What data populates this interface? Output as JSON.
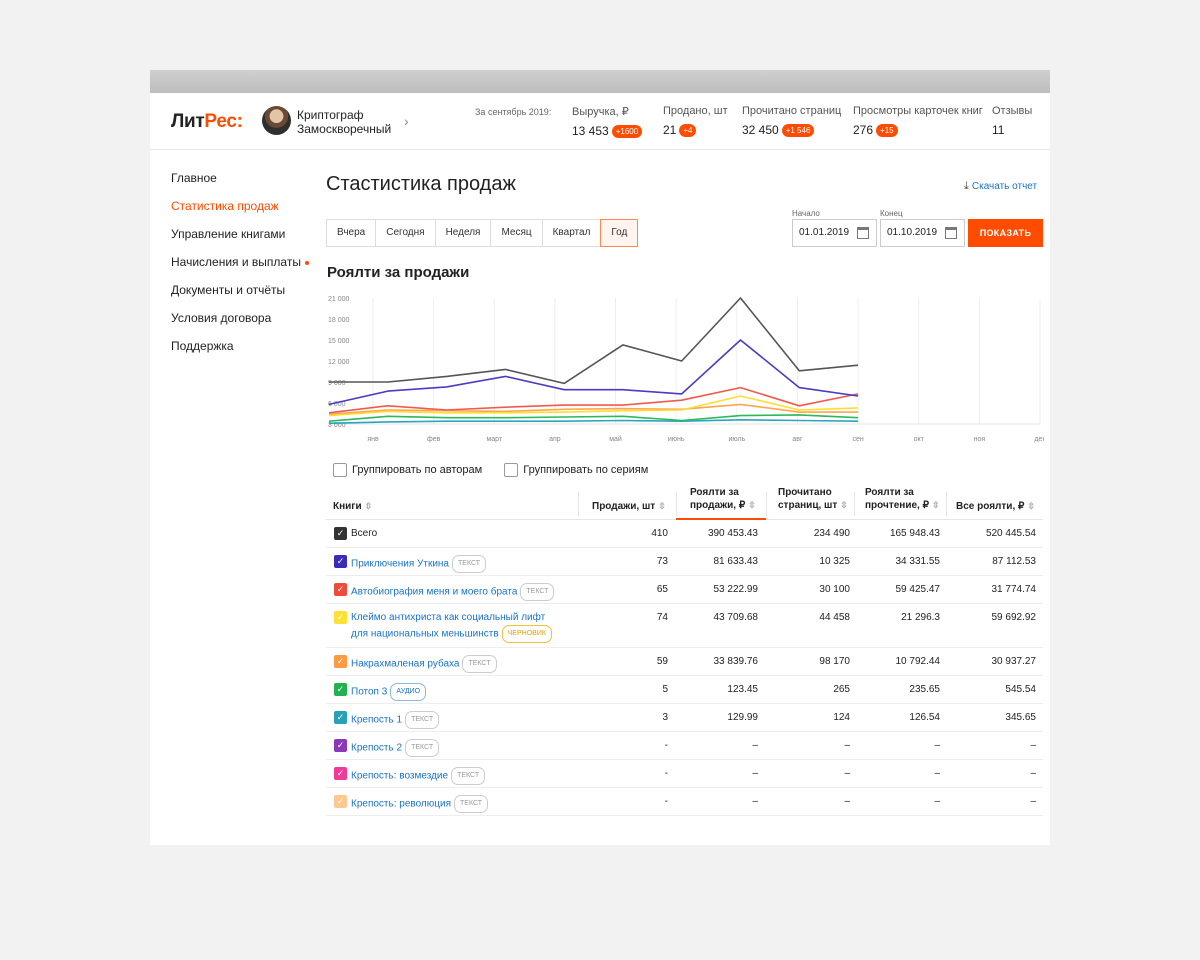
{
  "header": {
    "logo_part1": "Лит",
    "logo_part2": "Рес:",
    "user_name": "Криптограф Замоскворечный",
    "period": "За сентябрь 2019:",
    "stats": [
      {
        "label": "Выручка, ₽",
        "value": "13 453",
        "badge": "+1600"
      },
      {
        "label": "Продано, шт",
        "value": "21",
        "badge": "+4"
      },
      {
        "label": "Прочитано страниц",
        "value": "32 450",
        "badge": "+1 546"
      },
      {
        "label": "Просмотры карточек книг",
        "value": "276",
        "badge": "+15"
      },
      {
        "label": "Отзывы",
        "value": "11",
        "badge": ""
      }
    ]
  },
  "sidebar": {
    "items": [
      {
        "label": "Главное"
      },
      {
        "label": "Статистика продаж"
      },
      {
        "label": "Управление книгами"
      },
      {
        "label": "Начисления и выплаты"
      },
      {
        "label": "Документы и отчёты"
      },
      {
        "label": "Условия договора"
      },
      {
        "label": "Поддержка"
      }
    ]
  },
  "main": {
    "title": "Стастистика продаж",
    "download_label": "Скачать отчет",
    "tabs": [
      "Вчера",
      "Сегодня",
      "Неделя",
      "Месяц",
      "Квартал",
      "Год"
    ],
    "start_label": "Начало",
    "start_value": "01.01.2019",
    "end_label": "Конец",
    "end_value": "01.10.2019",
    "show_button": "ПОКАЗАТЬ",
    "section_title": "Роялти за продажи",
    "group_authors": "Группировать по авторам",
    "group_series": "Группировать по сериям"
  },
  "chart_data": {
    "type": "line",
    "x": [
      "янв",
      "фев",
      "март",
      "апр",
      "май",
      "июнь",
      "июль",
      "авг",
      "сен",
      "окт",
      "ноя",
      "дек"
    ],
    "y_ticks": [
      "21 000",
      "18 000",
      "15 000",
      "12 000",
      "9 000",
      "6 000",
      "3 000"
    ],
    "ylim": [
      3000,
      21000
    ],
    "grid": true,
    "series": [
      {
        "color": "#555555",
        "values": [
          9000,
          9000,
          9800,
          10800,
          8800,
          14300,
          12000,
          21000,
          10600,
          11400
        ]
      },
      {
        "color": "#4b3bc4",
        "values": [
          5800,
          7700,
          8300,
          9800,
          7900,
          7900,
          7300,
          15000,
          8200,
          7000
        ]
      },
      {
        "color": "#f05a4a",
        "values": [
          4600,
          5600,
          5000,
          5400,
          5700,
          5700,
          6400,
          8200,
          5600,
          7300
        ]
      },
      {
        "color": "#ffdd33",
        "values": [
          4200,
          4800,
          4600,
          4600,
          4700,
          4900,
          5000,
          7000,
          5000,
          5300
        ]
      },
      {
        "color": "#ffa64d",
        "values": [
          4400,
          5000,
          4900,
          4800,
          5100,
          5200,
          5100,
          5800,
          4700,
          4700
        ]
      },
      {
        "color": "#2eb85c",
        "values": [
          3400,
          4100,
          3900,
          3900,
          4000,
          4100,
          3500,
          4200,
          4300,
          3900
        ]
      },
      {
        "color": "#2aa6c0",
        "values": [
          3100,
          3300,
          3400,
          3400,
          3400,
          3500,
          3400,
          3600,
          3500,
          3400
        ]
      }
    ]
  },
  "table": {
    "headers": [
      "Книги",
      "Продажи, шт",
      "Роялти за продажи, ₽",
      "Прочитано страниц, шт",
      "Роялти за прочтение, ₽",
      "Все роялти, ₽"
    ],
    "header_lines": {
      "royalty_sales": [
        "Роялти за",
        "продажи, ₽"
      ],
      "pages": [
        "Прочитано",
        "страниц, шт"
      ],
      "royalty_read": [
        "Роялти за",
        "прочтение, ₽"
      ]
    },
    "rows": [
      {
        "title": "Всего",
        "tag": "",
        "color": "#333333",
        "sales": "410",
        "royalty": "390 453.43",
        "pages": "234 490",
        "read": "165 948.43",
        "total": "520 445.54"
      },
      {
        "title": "Приключения Уткина",
        "tag": "ТЕКСТ",
        "color": "#3a2bb8",
        "sales": "73",
        "royalty": "81 633.43",
        "pages": "10 325",
        "read": "34 331.55",
        "total": "87 112.53"
      },
      {
        "title": "Автобиография меня и моего брата",
        "tag": "ТЕКСТ",
        "color": "#f04a3a",
        "sales": "65",
        "royalty": "53 222.99",
        "pages": "30 100",
        "read": "59 425.47",
        "total": "31 774.74"
      },
      {
        "title": "Клеймо антихриста как социальный лифт",
        "title2": "для национальных меньшинств",
        "tag": "ЧЕРНОВИК",
        "color": "#ffe033",
        "sales": "74",
        "royalty": "43 709.68",
        "pages": "44 458",
        "read": "21 296.3",
        "total": "59 692.92"
      },
      {
        "title": "Накрахмаленая рубаха",
        "tag": "ТЕКСТ",
        "color": "#ff9a40",
        "sales": "59",
        "royalty": "33 839.76",
        "pages": "98 170",
        "read": "10 792.44",
        "total": "30 937.27"
      },
      {
        "title": "Потоп 3",
        "tag": "АУДИО",
        "color": "#22b050",
        "sales": "5",
        "royalty": "123.45",
        "pages": "265",
        "read": "235.65",
        "total": "545.54"
      },
      {
        "title": "Крепость 1",
        "tag": "ТЕКСТ",
        "color": "#2aa0b8",
        "sales": "3",
        "royalty": "129.99",
        "pages": "124",
        "read": "126.54",
        "total": "345.65"
      },
      {
        "title": "Крепость 2",
        "tag": "ТЕКСТ",
        "color": "#8a3ab8",
        "sales": "-",
        "royalty": "–",
        "pages": "–",
        "read": "–",
        "total": "–"
      },
      {
        "title": "Крепость: возмездие",
        "tag": "ТЕКСТ",
        "color": "#f03a98",
        "sales": "-",
        "royalty": "–",
        "pages": "–",
        "read": "–",
        "total": "–"
      },
      {
        "title": "Крепость: революция",
        "tag": "ТЕКСТ",
        "color": "#ffc890",
        "sales": "-",
        "royalty": "–",
        "pages": "–",
        "read": "–",
        "total": "–"
      }
    ]
  }
}
